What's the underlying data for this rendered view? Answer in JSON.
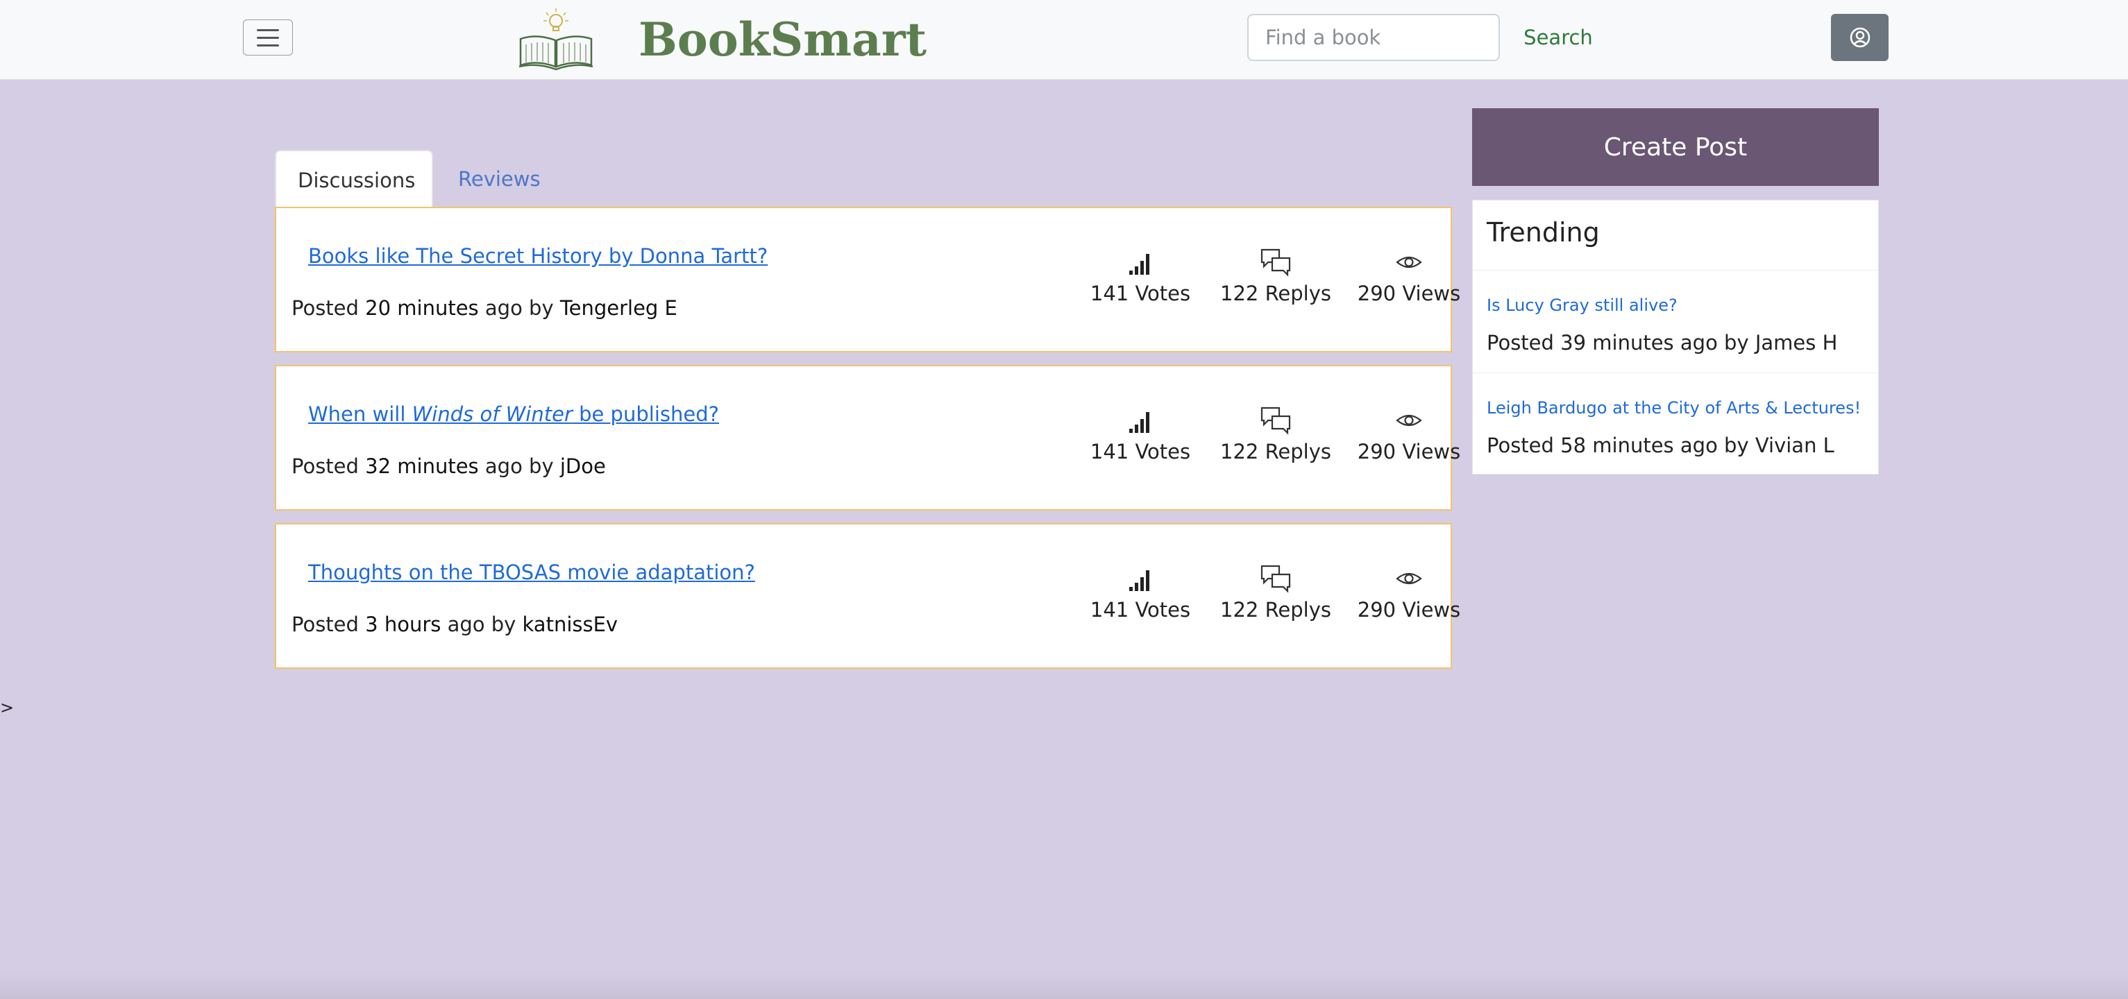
{
  "header": {
    "brand": "BookSmart",
    "search_placeholder": "Find a book",
    "search_label": "Search"
  },
  "tabs": [
    {
      "label": "Discussions",
      "active": true
    },
    {
      "label": "Reviews",
      "active": false
    }
  ],
  "discussions": [
    {
      "title_prefix": "Books like The Secret History by Donna Tartt?",
      "title_italic": "",
      "title_suffix": "",
      "posted_label": "Posted",
      "time": "20 minutes",
      "ago_by": "ago by",
      "author": "Tengerleg E",
      "votes": "141 Votes",
      "replies": "122 Replys",
      "views": "290 Views"
    },
    {
      "title_prefix": "When will ",
      "title_italic": "Winds of Winter",
      "title_suffix": " be published?",
      "posted_label": "Posted",
      "time": "32 minutes",
      "ago_by": "ago by",
      "author": "jDoe",
      "votes": "141 Votes",
      "replies": "122 Replys",
      "views": "290 Views"
    },
    {
      "title_prefix": "Thoughts on the TBOSAS movie adaptation?",
      "title_italic": "",
      "title_suffix": "",
      "posted_label": "Posted",
      "time": "3 hours",
      "ago_by": "ago by",
      "author": "katnissEv",
      "votes": "141 Votes",
      "replies": "122 Replys",
      "views": "290 Views"
    }
  ],
  "sidebar": {
    "create_post": "Create Post",
    "trending_title": "Trending",
    "trending": [
      {
        "title": "Is Lucy Gray still alive?",
        "posted_label": "Posted",
        "time": "39 minutes",
        "ago_by": "ago by",
        "author": "James H"
      },
      {
        "title": "Leigh Bardugo at the City of Arts & Lectures!",
        "posted_label": "Posted",
        "time": "58 minutes",
        "ago_by": "ago by",
        "author": "Vivian L"
      }
    ]
  },
  "stray_text": ">",
  "colors": {
    "background": "#d5cde3",
    "brand": "#5c7e4f",
    "create_post": "#6a5773",
    "link": "#1f6ad8",
    "card_border": "#f2c46a"
  },
  "icons": {
    "menu": "hamburger-icon",
    "logo": "book-lightbulb-logo",
    "profile": "user-circle-icon",
    "votes": "signal-bars-icon",
    "replies": "chat-bubbles-icon",
    "views": "eye-icon"
  }
}
